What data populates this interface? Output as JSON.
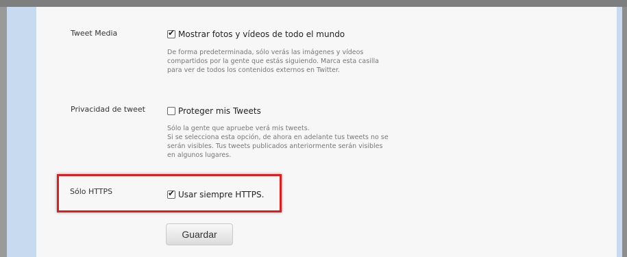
{
  "settings": {
    "media": {
      "label": "Tweet Media",
      "checkbox_label": "Mostrar fotos y vídeos de todo el mundo",
      "checked": true,
      "help": [
        "De forma predeterminada, sólo verás las imágenes y vídeos",
        "compartidos por la gente que estás siguiendo. Marca esta casilla",
        "para ver de todos los contenidos externos en Twitter."
      ]
    },
    "privacy": {
      "label": "Privacidad de tweet",
      "checkbox_label": "Proteger mis Tweets",
      "checked": false,
      "help": [
        "Sólo la gente que apruebe verá mis tweets.",
        "Si se selecciona esta opción, de ahora en adelante tus tweets no se",
        "serán visibles. Tus tweets publicados anteriormente serán visibles",
        "en algunos lugares."
      ]
    },
    "https": {
      "label": "Sólo HTTPS",
      "checkbox_label": "Usar siempre HTTPS.",
      "checked": true
    },
    "save_label": "Guardar"
  },
  "colors": {
    "highlight": "#e01c1c",
    "sidebar": "#c7daf0",
    "content_bg": "#f7f7f7"
  }
}
